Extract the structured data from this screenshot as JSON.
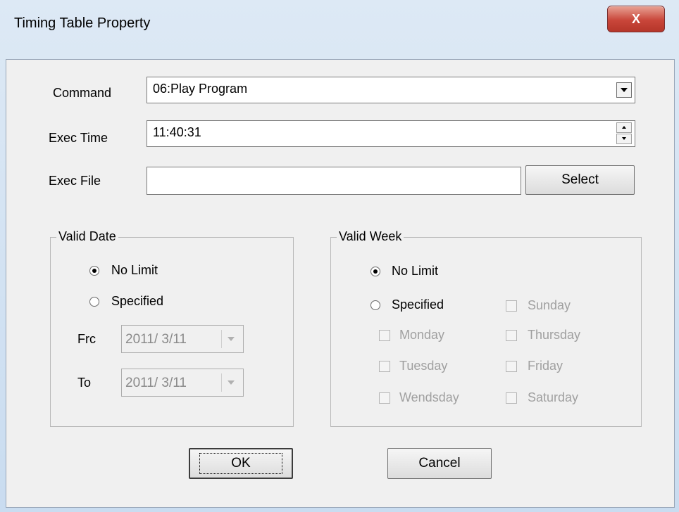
{
  "window": {
    "title": "Timing Table Property",
    "close_label": "X"
  },
  "form": {
    "command": {
      "label": "Command",
      "value": "06:Play Program"
    },
    "exec_time": {
      "label": "Exec Time",
      "value": "11:40:31"
    },
    "exec_file": {
      "label": "Exec File",
      "value": "",
      "select_label": "Select"
    }
  },
  "valid_date": {
    "title": "Valid Date",
    "no_limit_label": "No Limit",
    "specified_label": "Specified",
    "selected": "No Limit",
    "from_label": "Frc",
    "from_value": "2011/ 3/11",
    "to_label": "To",
    "to_value": "2011/ 3/11"
  },
  "valid_week": {
    "title": "Valid Week",
    "no_limit_label": "No Limit",
    "specified_label": "Specified",
    "selected": "No Limit",
    "days": {
      "sunday": "Sunday",
      "monday": "Monday",
      "thursday": "Thursday",
      "tuesday": "Tuesday",
      "friday": "Friday",
      "wendsday": "Wendsday",
      "saturday": "Saturday"
    }
  },
  "buttons": {
    "ok": "OK",
    "cancel": "Cancel"
  }
}
